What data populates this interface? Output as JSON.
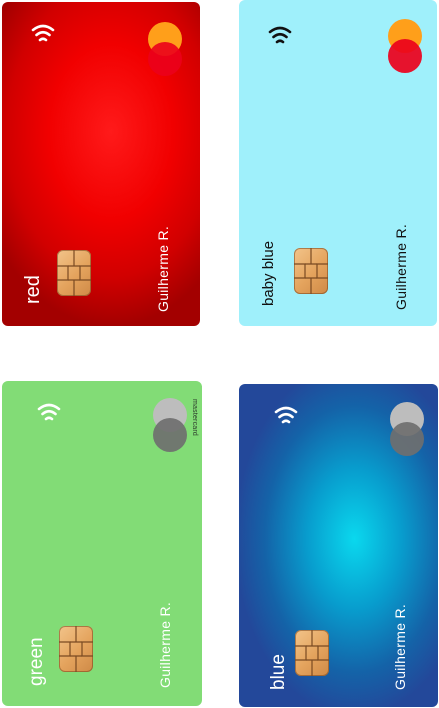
{
  "cards": [
    {
      "name": "red",
      "holder": "Guilherme R.",
      "color": "#f10000",
      "icons": [
        "contactless-icon",
        "mastercard-logo",
        "chip"
      ],
      "logo_colors": [
        "#ff9f1a",
        "#eb001b"
      ]
    },
    {
      "name": "baby blue",
      "holder": "Guilherme R.",
      "color": "#9ff0fb",
      "icons": [
        "contactless-icon",
        "mastercard-logo",
        "chip"
      ],
      "logo_colors": [
        "#ff9f1a",
        "#eb001b"
      ]
    },
    {
      "name": "green",
      "holder": "Guilherme R.",
      "brand_text": "mastercard",
      "color": "#82dc76",
      "icons": [
        "contactless-icon",
        "mastercard-logo",
        "chip"
      ],
      "logo_colors": [
        "#bdbdbd",
        "#6f6f6f"
      ]
    },
    {
      "name": "blue",
      "holder": "Guilherme R.",
      "color": "#0ad8ee",
      "icons": [
        "contactless-icon",
        "mastercard-logo",
        "chip"
      ],
      "logo_colors": [
        "#bdbdbd",
        "#6f6f6f"
      ]
    }
  ]
}
